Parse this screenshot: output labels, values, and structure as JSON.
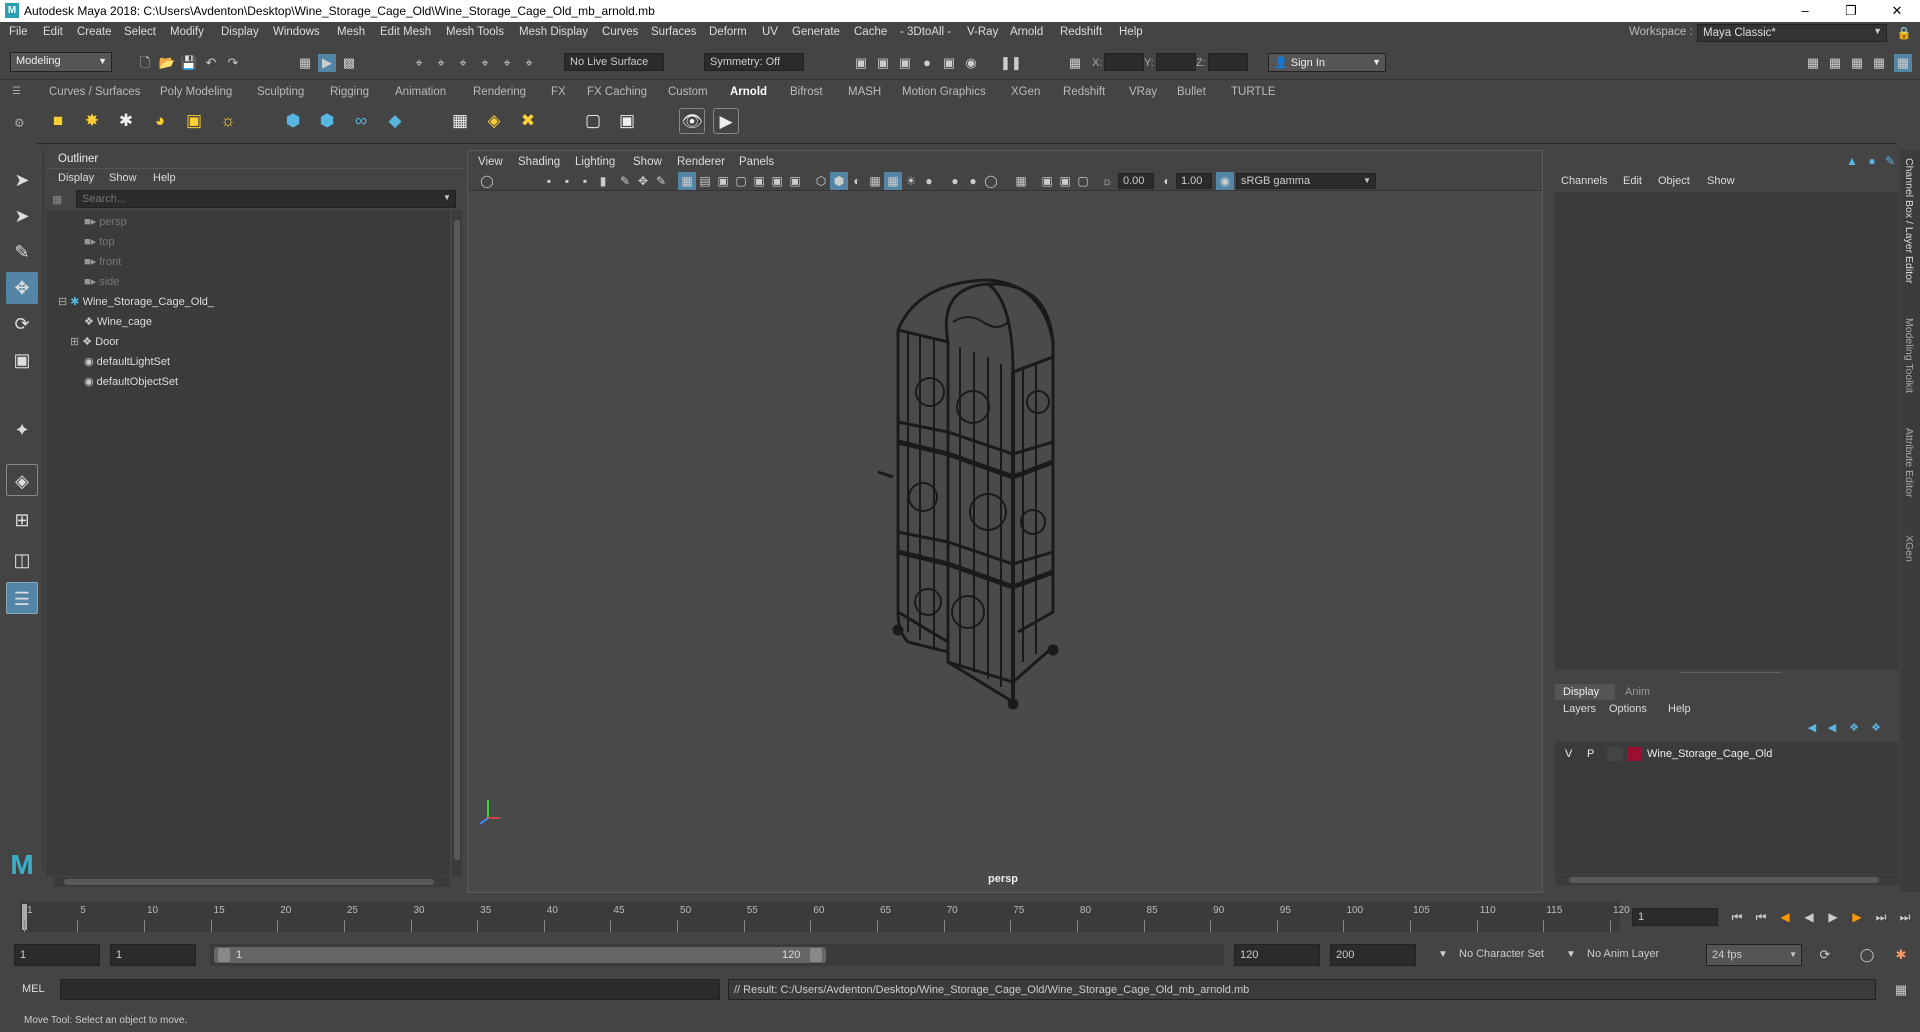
{
  "title": "Autodesk Maya 2018: C:\\Users\\Avdenton\\Desktop\\Wine_Storage_Cage_Old\\Wine_Storage_Cage_Old_mb_arnold.mb",
  "menus": [
    "File",
    "Edit",
    "Create",
    "Select",
    "Modify",
    "Display",
    "Windows",
    "Mesh",
    "Edit Mesh",
    "Mesh Tools",
    "Mesh Display",
    "Curves",
    "Surfaces",
    "Deform",
    "UV",
    "Generate",
    "Cache",
    "- 3DtoAll -",
    "V-Ray",
    "Arnold",
    "Redshift",
    "Help"
  ],
  "workspace_label": "Workspace :",
  "workspace_value": "Maya Classic*",
  "mode": "Modeling",
  "live_surface": "No Live Surface",
  "symmetry": "Symmetry: Off",
  "xyz": {
    "x": "X:",
    "y": "Y:",
    "z": "Z:"
  },
  "sign_in": "Sign In",
  "shelf_tabs": [
    "Curves / Surfaces",
    "Poly Modeling",
    "Sculpting",
    "Rigging",
    "Animation",
    "Rendering",
    "FX",
    "FX Caching",
    "Custom",
    "Arnold",
    "Bifrost",
    "MASH",
    "Motion Graphics",
    "XGen",
    "Redshift",
    "VRay",
    "Bullet",
    "TURTLE"
  ],
  "active_shelf_tab": "Arnold",
  "outliner": {
    "title": "Outliner",
    "menus": [
      "Display",
      "Show",
      "Help"
    ],
    "search_placeholder": "Search...",
    "items": [
      {
        "label": "persp",
        "dim": true,
        "icon": "camera-icon"
      },
      {
        "label": "top",
        "dim": true,
        "icon": "camera-icon"
      },
      {
        "label": "front",
        "dim": true,
        "icon": "camera-icon"
      },
      {
        "label": "side",
        "dim": true,
        "icon": "camera-icon"
      },
      {
        "label": "Wine_Storage_Cage_Old_",
        "dim": false,
        "icon": "group-icon"
      },
      {
        "label": "Wine_cage",
        "dim": false,
        "icon": "mesh-icon"
      },
      {
        "label": "Door",
        "dim": false,
        "icon": "mesh-icon"
      },
      {
        "label": "defaultLightSet",
        "dim": false,
        "icon": "set-icon"
      },
      {
        "label": "defaultObjectSet",
        "dim": false,
        "icon": "set-icon"
      }
    ]
  },
  "viewport": {
    "menus": [
      "View",
      "Shading",
      "Lighting",
      "Show",
      "Renderer",
      "Panels"
    ],
    "exposure": "0.00",
    "gamma": "1.00",
    "colorspace": "sRGB gamma",
    "camera_label": "persp"
  },
  "channel_box": {
    "menus": [
      "Channels",
      "Edit",
      "Object",
      "Show"
    ]
  },
  "layer_editor": {
    "tabs": [
      "Display",
      "Anim"
    ],
    "menus": [
      "Layers",
      "Options",
      "Help"
    ],
    "layer": {
      "v": "V",
      "p": "P",
      "name": "Wine_Storage_Cage_Old",
      "color": "#9b1030"
    }
  },
  "side_tabs": [
    "Channel Box / Layer Editor",
    "Modeling Toolkit",
    "Attribute Editor",
    "XGen"
  ],
  "timeline": {
    "ticks": [
      "1",
      "5",
      "10",
      "15",
      "20",
      "25",
      "30",
      "35",
      "40",
      "45",
      "50",
      "55",
      "60",
      "65",
      "70",
      "75",
      "80",
      "85",
      "90",
      "95",
      "100",
      "105",
      "110",
      "115",
      "120"
    ],
    "current_frame": "1"
  },
  "range": {
    "start": "1",
    "inner_start": "1",
    "slider_start": "1",
    "slider_end": "120",
    "end": "120",
    "outer_end": "200",
    "character_set": "No Character Set",
    "anim_layer": "No Anim Layer",
    "fps": "24 fps"
  },
  "command": {
    "lang": "MEL",
    "result": "// Result: C:/Users/Avdenton/Desktop/Wine_Storage_Cage_Old/Wine_Storage_Cage_Old_mb_arnold.mb"
  },
  "help_line": "Move Tool: Select an object to move.",
  "colors": {
    "accent": "#5285a6",
    "active_tool": "#5285a6",
    "layer": "#9b1030"
  }
}
